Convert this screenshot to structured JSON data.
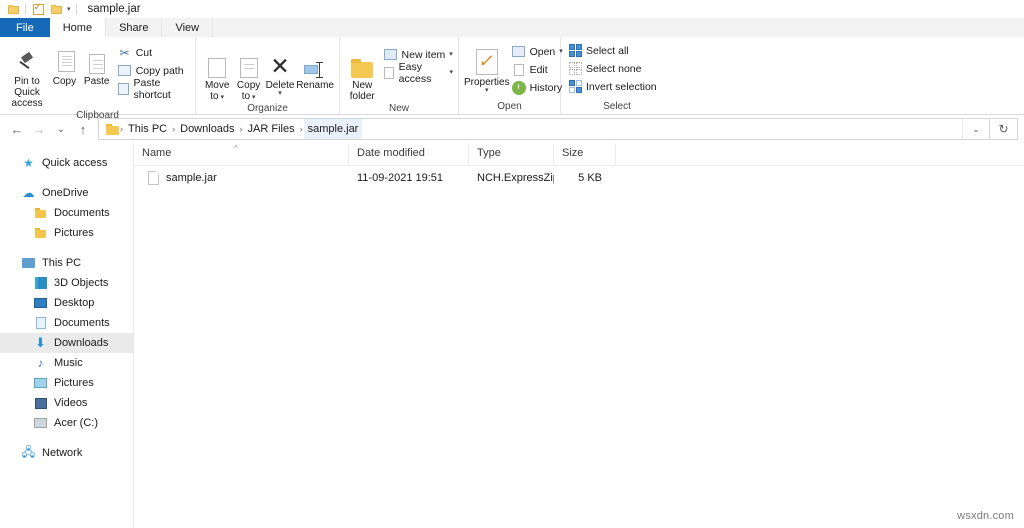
{
  "window": {
    "title": "sample.jar",
    "quick_access_toolbar": [
      {
        "name": "folder-icon",
        "label": ""
      },
      {
        "name": "properties-icon",
        "label": ""
      },
      {
        "name": "new-folder-icon",
        "label": ""
      },
      {
        "name": "customize-caret",
        "label": "▾"
      }
    ]
  },
  "ribbon": {
    "tabs": [
      {
        "label": "File",
        "active": false,
        "kind": "file"
      },
      {
        "label": "Home",
        "active": true,
        "kind": "normal"
      },
      {
        "label": "Share",
        "active": false,
        "kind": "normal"
      },
      {
        "label": "View",
        "active": false,
        "kind": "normal"
      }
    ],
    "groups": {
      "clipboard": {
        "title": "Clipboard",
        "pin_label_line1": "Pin to Quick",
        "pin_label_line2": "access",
        "copy_label": "Copy",
        "paste_label": "Paste",
        "cut_label": "Cut",
        "copy_path_label": "Copy path",
        "paste_shortcut_label": "Paste shortcut"
      },
      "organize": {
        "title": "Organize",
        "move_to_line1": "Move",
        "move_to_line2": "to",
        "copy_to_line1": "Copy",
        "copy_to_line2": "to",
        "delete_label": "Delete",
        "rename_label": "Rename"
      },
      "new": {
        "title": "New",
        "new_folder_line1": "New",
        "new_folder_line2": "folder",
        "new_item_label": "New item",
        "easy_access_label": "Easy access"
      },
      "open": {
        "title": "Open",
        "properties_label": "Properties",
        "open_label": "Open",
        "edit_label": "Edit",
        "history_label": "History"
      },
      "select": {
        "title": "Select",
        "select_all_label": "Select all",
        "select_none_label": "Select none",
        "invert_selection_label": "Invert selection"
      }
    }
  },
  "address_bar": {
    "back_glyph": "←",
    "forward_glyph": "→",
    "recent_glyph": "⌄",
    "up_glyph": "↑",
    "breadcrumbs": [
      "This PC",
      "Downloads",
      "JAR Files",
      "sample.jar"
    ],
    "separator": "›",
    "dropdown_glyph": "⌄",
    "refresh_glyph": "↻"
  },
  "navigation_pane": {
    "items": [
      {
        "label": "Quick access",
        "icon": "star-icon",
        "indent": 0,
        "selected": false,
        "gap_before": false
      },
      {
        "label": "OneDrive",
        "icon": "cloud-icon",
        "indent": 0,
        "selected": false,
        "gap_before": true
      },
      {
        "label": "Documents",
        "icon": "folder-icon",
        "indent": 1,
        "selected": false,
        "gap_before": false
      },
      {
        "label": "Pictures",
        "icon": "folder-icon",
        "indent": 1,
        "selected": false,
        "gap_before": false
      },
      {
        "label": "This PC",
        "icon": "this-pc-icon",
        "indent": 0,
        "selected": false,
        "gap_before": true
      },
      {
        "label": "3D Objects",
        "icon": "cube-icon",
        "indent": 1,
        "selected": false,
        "gap_before": false
      },
      {
        "label": "Desktop",
        "icon": "desktop-icon",
        "indent": 1,
        "selected": false,
        "gap_before": false
      },
      {
        "label": "Documents",
        "icon": "documents-icon",
        "indent": 1,
        "selected": false,
        "gap_before": false
      },
      {
        "label": "Downloads",
        "icon": "downloads-icon",
        "indent": 1,
        "selected": true,
        "gap_before": false
      },
      {
        "label": "Music",
        "icon": "music-icon",
        "indent": 1,
        "selected": false,
        "gap_before": false
      },
      {
        "label": "Pictures",
        "icon": "pictures-icon",
        "indent": 1,
        "selected": false,
        "gap_before": false
      },
      {
        "label": "Videos",
        "icon": "videos-icon",
        "indent": 1,
        "selected": false,
        "gap_before": false
      },
      {
        "label": "Acer (C:)",
        "icon": "drive-icon",
        "indent": 1,
        "selected": false,
        "gap_before": false
      },
      {
        "label": "Network",
        "icon": "network-icon",
        "indent": 0,
        "selected": false,
        "gap_before": true
      }
    ]
  },
  "file_list": {
    "columns": [
      "Name",
      "Date modified",
      "Type",
      "Size"
    ],
    "sort_column": "Name",
    "sort_glyph": "^",
    "rows": [
      {
        "name": "sample.jar",
        "date_modified": "11-09-2021 19:51",
        "type": "NCH.ExpressZip.jar",
        "size": "5 KB",
        "icon": "generic-file-icon"
      }
    ]
  },
  "watermark": "wsxdn.com"
}
